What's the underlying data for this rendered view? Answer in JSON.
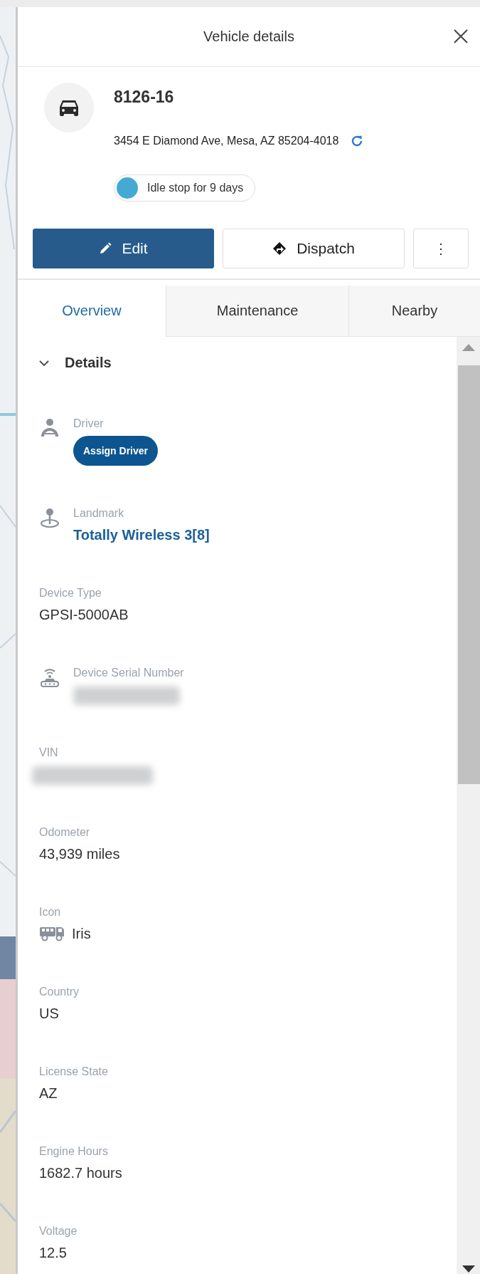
{
  "header": {
    "title": "Vehicle details"
  },
  "vehicle": {
    "name": "8126-16",
    "address": "3454 E Diamond Ave, Mesa, AZ 85204-4018",
    "status": {
      "label": "Idle stop for 9 days",
      "kind": "idle"
    }
  },
  "actions": [
    {
      "kind": "primary",
      "label": "Edit"
    },
    {
      "kind": "secondary",
      "label": "Dispatch"
    },
    {
      "kind": "more",
      "label": "⋮"
    }
  ],
  "tabs": [
    {
      "label": "Overview",
      "selected": true
    },
    {
      "label": "Maintenance",
      "selected": false
    },
    {
      "label": "Nearby",
      "selected": false
    }
  ],
  "section": {
    "title": "Details",
    "expanded": true
  },
  "fields": [
    {
      "label": "Driver",
      "kind": "button",
      "value": "Assign Driver"
    },
    {
      "label": "Landmark",
      "kind": "link",
      "value": "Totally Wireless 3[8]"
    },
    {
      "label": "Device Type",
      "kind": "text",
      "value": "GPSI-5000AB"
    },
    {
      "label": "Device Serial Number",
      "kind": "redacted"
    },
    {
      "label": "VIN",
      "kind": "redacted"
    },
    {
      "label": "Odometer",
      "kind": "text",
      "value": "43,939 miles"
    },
    {
      "label": "Icon",
      "kind": "vehicle-icon",
      "value": "Iris"
    },
    {
      "label": "Country",
      "kind": "text",
      "value": "US"
    },
    {
      "label": "License State",
      "kind": "text",
      "value": "AZ"
    },
    {
      "label": "Engine Hours",
      "kind": "text",
      "value": "1682.7 hours"
    },
    {
      "label": "Voltage",
      "kind": "text",
      "value": "12.5"
    }
  ]
}
